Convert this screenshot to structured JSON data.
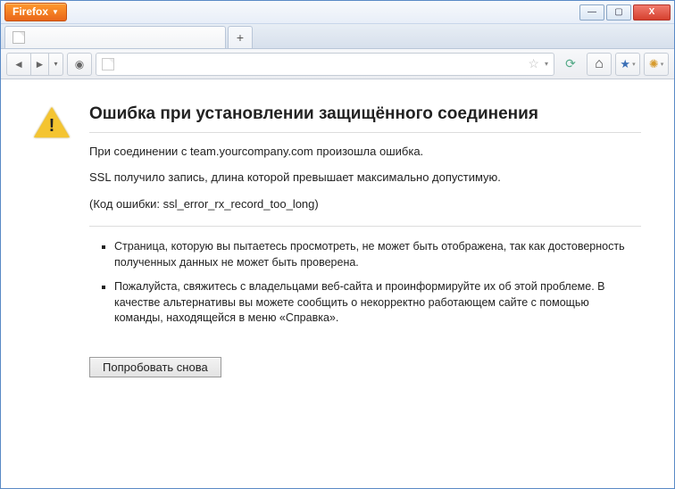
{
  "window": {
    "app_button_label": "Firefox",
    "controls": {
      "min": "—",
      "max": "▢",
      "close": "X"
    }
  },
  "tabs": {
    "new_tab_glyph": "+"
  },
  "navbar": {
    "back_glyph": "◄",
    "fwd_glyph": "►",
    "history_glyph": "▾",
    "bookmark_glyph": "◉",
    "star_glyph": "☆",
    "dropdown_glyph": "▾",
    "reload_glyph": "⟳"
  },
  "error": {
    "title": "Ошибка при установлении защищённого соединения",
    "line1": "При соединении с team.yourcompany.com произошла ошибка.",
    "line2": "SSL получило запись, длина которой превышает максимально допустимую.",
    "code_line": "(Код ошибки: ssl_error_rx_record_too_long)",
    "bullet1": "Страница, которую вы пытаетесь просмотреть, не может быть отображена, так как достоверность полученных данных не может быть проверена.",
    "bullet2": "Пожалуйста, свяжитесь с владельцами веб-сайта и проинформируйте их об этой проблеме. В качестве альтернативы вы можете сообщить о некорректно работающем сайте с помощью команды, находящейся в меню «Справка».",
    "retry_label": "Попробовать снова"
  }
}
